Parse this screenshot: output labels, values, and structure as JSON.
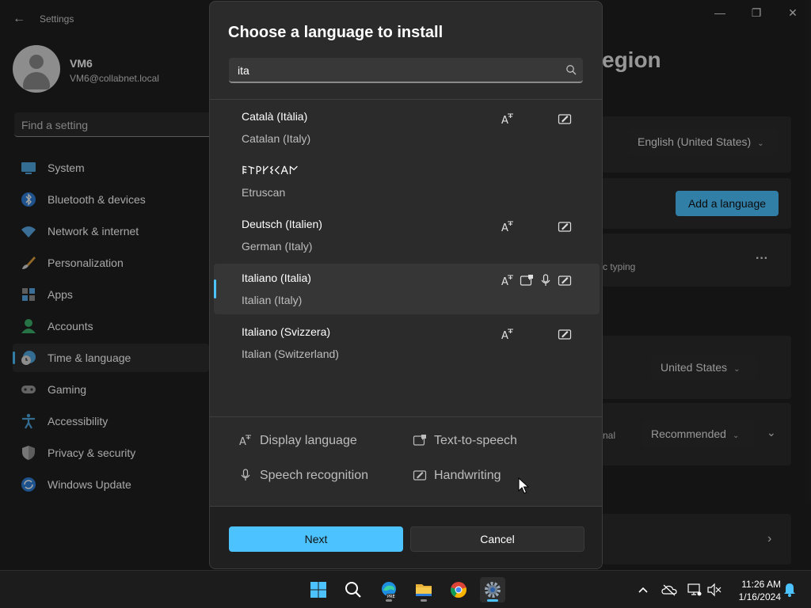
{
  "window": {
    "title": "Settings",
    "back_glyph": "←",
    "minimize_glyph": "—",
    "maximize_glyph": "❐",
    "close_glyph": "✕"
  },
  "profile": {
    "name": "VM6",
    "email": "VM6@collabnet.local"
  },
  "sidebar": {
    "search_placeholder": "Find a setting",
    "items": [
      {
        "label": "System",
        "icon": "system-icon"
      },
      {
        "label": "Bluetooth & devices",
        "icon": "bluetooth-icon"
      },
      {
        "label": "Network & internet",
        "icon": "network-icon"
      },
      {
        "label": "Personalization",
        "icon": "brush-icon"
      },
      {
        "label": "Apps",
        "icon": "apps-icon"
      },
      {
        "label": "Accounts",
        "icon": "accounts-icon"
      },
      {
        "label": "Time & language",
        "icon": "time-language-icon"
      },
      {
        "label": "Gaming",
        "icon": "gaming-icon"
      },
      {
        "label": "Accessibility",
        "icon": "accessibility-icon"
      },
      {
        "label": "Privacy & security",
        "icon": "shield-icon"
      },
      {
        "label": "Windows Update",
        "icon": "update-icon"
      }
    ],
    "active": "Time & language"
  },
  "background_page": {
    "title_fragment": "egion",
    "display_language": "English (United States)",
    "add_language_label": "Add a language",
    "typing_fragment": "c typing",
    "more_glyph": "···",
    "country": "United States",
    "format_fragment": "nal",
    "regional_format": "Recommended"
  },
  "dialog": {
    "title": "Choose a language to install",
    "search_value": "ita",
    "languages": [
      {
        "native": "Català (Itàlia)",
        "english": "Catalan (Italy)",
        "features": [
          "display",
          "handwriting"
        ]
      },
      {
        "native": "𐌄𐌕𐌓𐌖𐌔𐌂𐌀𐌍",
        "english": "Etruscan",
        "features": []
      },
      {
        "native": "Deutsch (Italien)",
        "english": "German (Italy)",
        "features": [
          "display",
          "handwriting"
        ]
      },
      {
        "native": "Italiano (Italia)",
        "english": "Italian (Italy)",
        "features": [
          "display",
          "tts",
          "speech",
          "handwriting"
        ]
      },
      {
        "native": "Italiano (Svizzera)",
        "english": "Italian (Switzerland)",
        "features": [
          "display",
          "handwriting"
        ]
      }
    ],
    "selected": "Italiano (Italia)",
    "legend": {
      "display": "Display language",
      "tts": "Text-to-speech",
      "speech": "Speech recognition",
      "handwriting": "Handwriting"
    },
    "next_label": "Next",
    "cancel_label": "Cancel"
  },
  "taskbar": {
    "apps": [
      "start-icon",
      "search-icon",
      "edge-icon",
      "file-explorer-icon",
      "chrome-icon",
      "settings-icon"
    ],
    "time": "11:26 AM",
    "date": "1/16/2024",
    "accent": "#4cc2ff"
  }
}
